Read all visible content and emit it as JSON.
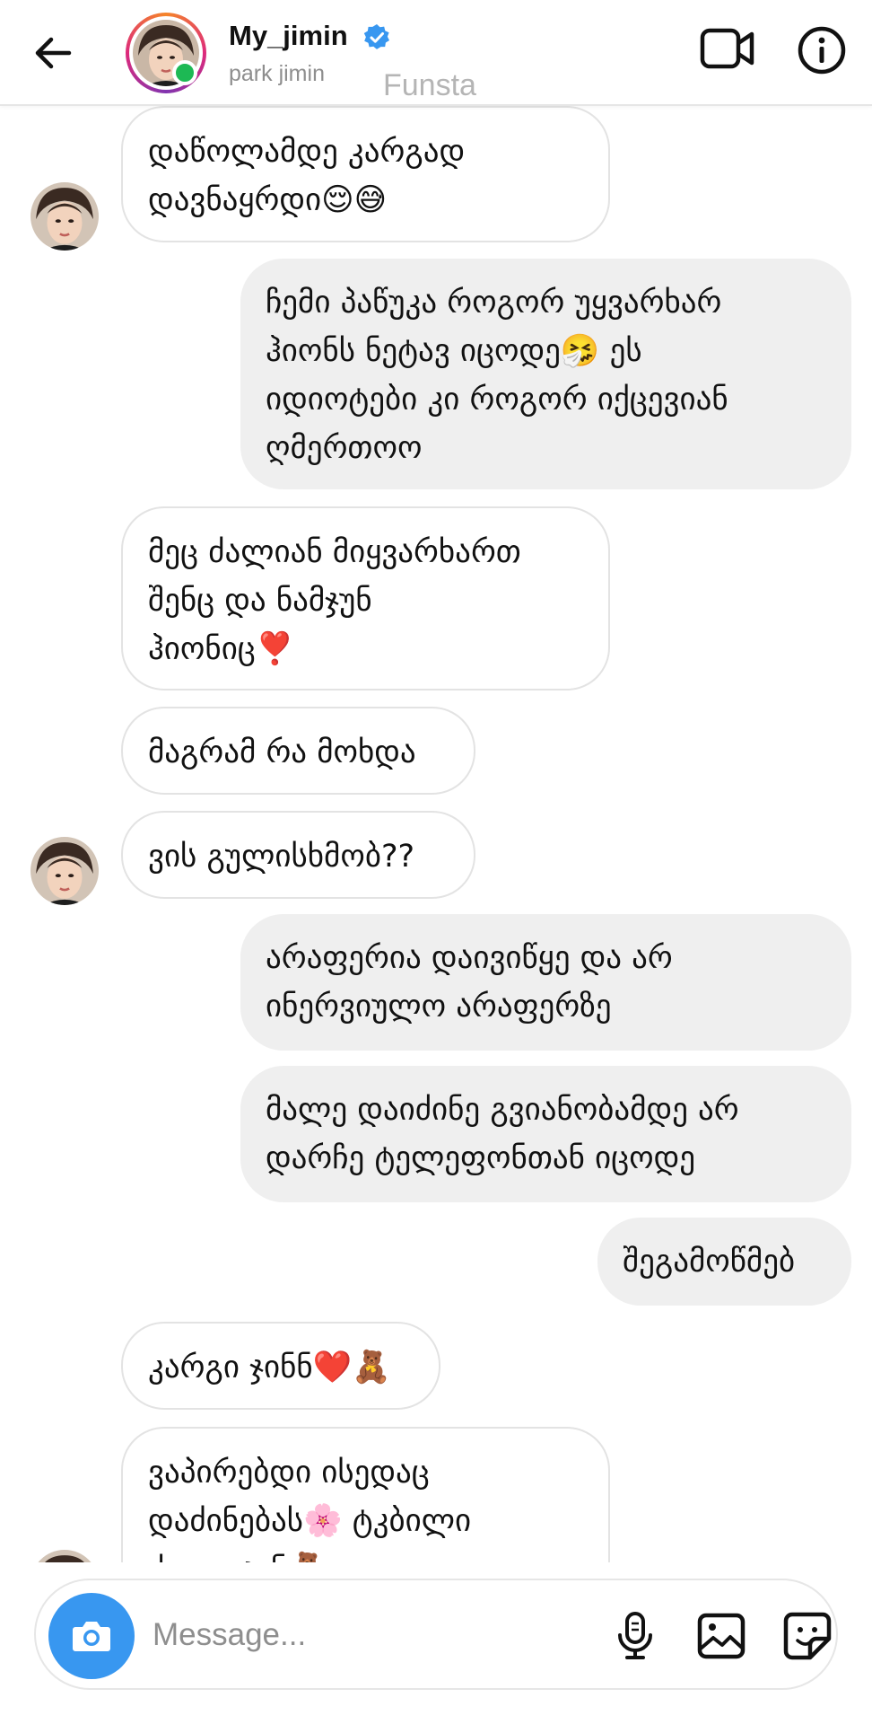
{
  "header": {
    "username": "My_jimin",
    "real_name": "park jimin",
    "watermark": "Funsta",
    "icons": {
      "back": "back-arrow-icon",
      "verified": "verified-badge-icon",
      "video": "video-call-icon",
      "info": "info-icon"
    },
    "colors": {
      "verified": "#3897f0",
      "online": "#1db954"
    }
  },
  "messages": [
    {
      "side": "in",
      "text": "დაწოლამდე კარგად\nდავნაყრდი😌😅"
    },
    {
      "side": "out",
      "text": "ჩემი პაწუკა როგორ უყვარხარ\nჰიონს ნეტავ იცოდე🤧 ეს\nიდიოტები კი როგორ იქცევიან\nღმერთოო"
    },
    {
      "side": "in",
      "text": "მეც ძალიან მიყვარხართ\nშენც და ნამჯუნ\nჰიონიც❣️"
    },
    {
      "side": "in",
      "text": "მაგრამ რა მოხდა"
    },
    {
      "side": "in",
      "text": "ვის გულისხმობ??"
    },
    {
      "side": "out",
      "text": "არაფერია დაივიწყე და არ\nინერვიულო არაფერზე"
    },
    {
      "side": "out",
      "text": "მალე დაიძინე გვიანობამდე არ\nდარჩე ტელეფონთან იცოდე"
    },
    {
      "side": "out",
      "text": "შეგამოწმებ"
    },
    {
      "side": "in",
      "text": "კარგი ჯინნ❤️🧸"
    },
    {
      "side": "in",
      "text": "ვაპირებდი ისედაც\nდაძინებას🌸 ტკბილი\nძილი ჯინ🧸"
    }
  ],
  "composer": {
    "placeholder": "Message...",
    "icons": {
      "camera": "camera-icon",
      "mic": "microphone-icon",
      "gallery": "gallery-icon",
      "sticker": "sticker-icon"
    },
    "colors": {
      "camera_bg": "#3897f0"
    }
  }
}
